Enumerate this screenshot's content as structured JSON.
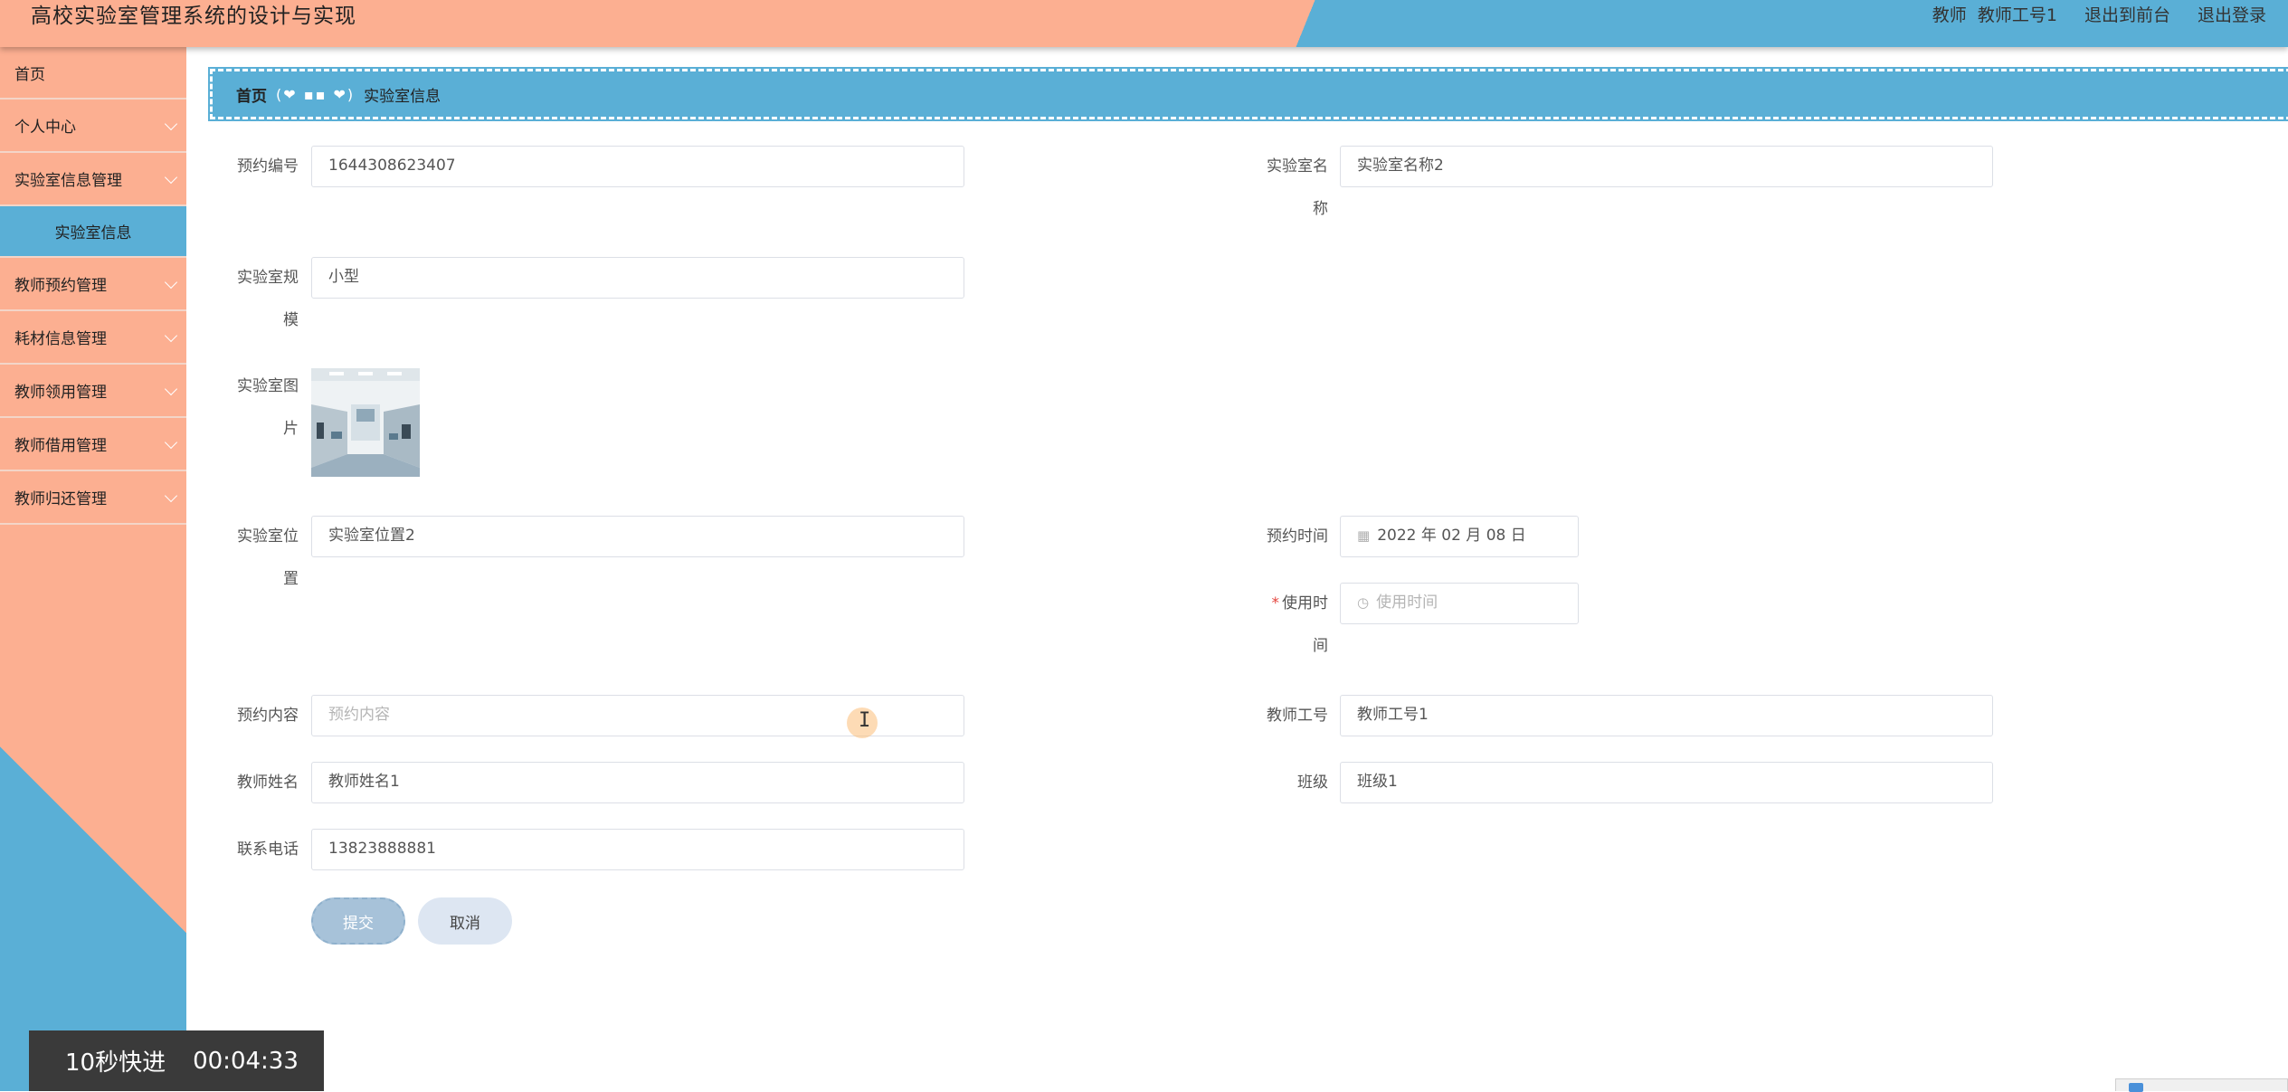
{
  "header": {
    "title": "高校实验室管理系统的设计与实现",
    "user_role": "教师",
    "user_name": "教师工号1",
    "front_link": "退出到前台",
    "logout_link": "退出登录"
  },
  "sidebar": {
    "items": [
      {
        "label": "首页",
        "expandable": false
      },
      {
        "label": "个人中心",
        "expandable": true
      },
      {
        "label": "实验室信息管理",
        "expandable": true
      },
      {
        "label": "实验室信息",
        "sub": true
      },
      {
        "label": "教师预约管理",
        "expandable": true
      },
      {
        "label": "耗材信息管理",
        "expandable": true
      },
      {
        "label": "教师领用管理",
        "expandable": true
      },
      {
        "label": "教师借用管理",
        "expandable": true
      },
      {
        "label": "教师归还管理",
        "expandable": true
      }
    ]
  },
  "breadcrumb": {
    "home": "首页",
    "current": "实验室信息"
  },
  "form": {
    "booking_no_label": "预约编号",
    "booking_no_value": "1644308623407",
    "lab_name_label": "实验室名称",
    "lab_name_value": "实验室名称2",
    "lab_size_label": "实验室规模",
    "lab_size_value": "小型",
    "lab_image_label": "实验室图片",
    "lab_location_label": "实验室位置",
    "lab_location_value": "实验室位置2",
    "booking_time_label": "预约时间",
    "booking_time_value": "2022 年 02 月 08 日",
    "use_time_label": "使用时间",
    "use_time_placeholder": "使用时间",
    "booking_content_label": "预约内容",
    "booking_content_placeholder": "预约内容",
    "teacher_no_label": "教师工号",
    "teacher_no_value": "教师工号1",
    "teacher_name_label": "教师姓名",
    "teacher_name_value": "教师姓名1",
    "class_label": "班级",
    "class_value": "班级1",
    "phone_label": "联系电话",
    "phone_value": "13823888881",
    "submit_label": "提交",
    "cancel_label": "取消"
  },
  "overlay": {
    "fast_forward": "10秒快进",
    "time": "00:04:33"
  },
  "colors": {
    "salmon": "#fcaf91",
    "blue": "#5aafd6",
    "required": "#e4463f"
  }
}
